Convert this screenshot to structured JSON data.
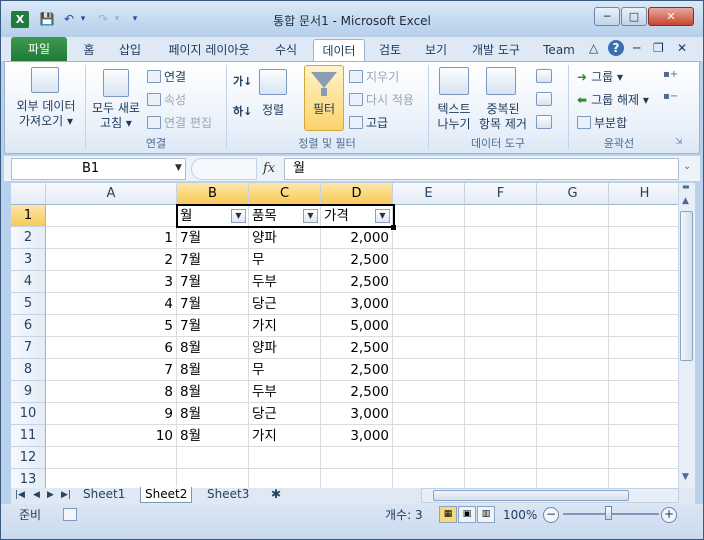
{
  "window": {
    "title": "통합 문서1 - Microsoft Excel",
    "app_icon": "excel-icon",
    "controls": {
      "minimize": "─",
      "maximize": "□",
      "close": "✕"
    }
  },
  "qat": {
    "save": "💾",
    "undo": "↶",
    "redo": "↷",
    "customize": "▾"
  },
  "tabs": [
    {
      "label": "파일"
    },
    {
      "label": "홈"
    },
    {
      "label": "삽입"
    },
    {
      "label": "페이지 레이아웃"
    },
    {
      "label": "수식"
    },
    {
      "label": "데이터"
    },
    {
      "label": "검토"
    },
    {
      "label": "보기"
    },
    {
      "label": "개발 도구"
    },
    {
      "label": "Team"
    }
  ],
  "ribbon_right": {
    "collapse": "△",
    "help": "?",
    "min": "─",
    "restore": "❐",
    "close": "✕"
  },
  "ribbon": {
    "external_data": {
      "line1": "외부 데이터",
      "line2": "가져오기 ▾"
    },
    "refresh_all": {
      "line1": "모두 새로",
      "line2": "고침 ▾"
    },
    "connections": "연결",
    "properties": "속성",
    "edit_links": "연결 편집",
    "group_connections": "연결",
    "sort_az": "가↓",
    "sort_za": "하↓",
    "sort": "정렬",
    "filter": "필터",
    "clear": "지우기",
    "reapply": "다시 적용",
    "advanced": "고급",
    "group_sort_filter": "정렬 및 필터",
    "text_to_columns": {
      "line1": "텍스트",
      "line2": "나누기"
    },
    "remove_duplicates": {
      "line1": "중복된",
      "line2": "항목 제거"
    },
    "group_data_tools": "데이터 도구",
    "group": "그룹 ▾",
    "ungroup": "그룹 해제 ▾",
    "subtotal": "부분합",
    "group_outline": "윤곽선"
  },
  "formula_bar": {
    "name_box": "B1",
    "fx": "fx",
    "content": "월"
  },
  "grid": {
    "columns": [
      "A",
      "B",
      "C",
      "D",
      "E",
      "F",
      "G",
      "H"
    ],
    "rows": [
      "1",
      "2",
      "3",
      "4",
      "5",
      "6",
      "7",
      "8",
      "9",
      "10",
      "11",
      "12",
      "13"
    ],
    "header": [
      "월",
      "품목",
      "가격"
    ],
    "data": [
      {
        "a": "1",
        "b": "7월",
        "c": "양파",
        "d": "2,000"
      },
      {
        "a": "2",
        "b": "7월",
        "c": "무",
        "d": "2,500"
      },
      {
        "a": "3",
        "b": "7월",
        "c": "두부",
        "d": "2,500"
      },
      {
        "a": "4",
        "b": "7월",
        "c": "당근",
        "d": "3,000"
      },
      {
        "a": "5",
        "b": "7월",
        "c": "가지",
        "d": "5,000"
      },
      {
        "a": "6",
        "b": "8월",
        "c": "양파",
        "d": "2,500"
      },
      {
        "a": "7",
        "b": "8월",
        "c": "무",
        "d": "2,500"
      },
      {
        "a": "8",
        "b": "8월",
        "c": "두부",
        "d": "2,500"
      },
      {
        "a": "9",
        "b": "8월",
        "c": "당근",
        "d": "3,000"
      },
      {
        "a": "10",
        "b": "8월",
        "c": "가지",
        "d": "3,000"
      }
    ]
  },
  "sheets": [
    {
      "label": "Sheet1"
    },
    {
      "label": "Sheet2"
    },
    {
      "label": "Sheet3"
    }
  ],
  "status": {
    "ready": "준비",
    "count": "개수: 3",
    "zoom": "100%",
    "zoom_minus": "−",
    "zoom_plus": "+"
  },
  "colors": {
    "accent": "#1f7a34",
    "selection_header": "#f7c957",
    "ribbon_bg": "#dfe9f5"
  }
}
